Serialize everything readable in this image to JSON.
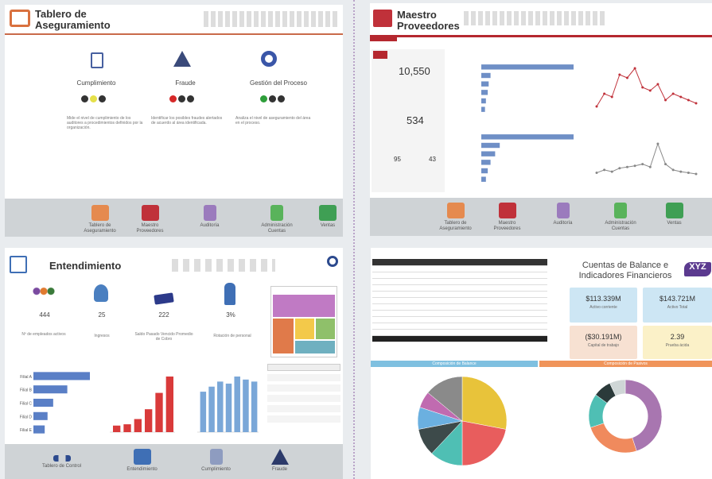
{
  "panel1": {
    "title_line1": "Tablero de",
    "title_line2": "Aseguramiento",
    "sections": [
      {
        "label": "Cumplimiento",
        "text": "Mide el nivel de cumplimiento de los auditores a procedimientos definidos por la organización."
      },
      {
        "label": "Fraude",
        "text": "Identificar los posibles fraudes alertados de acuerdo al área identificada."
      },
      {
        "label": "Gestión del Proceso",
        "text": "Analiza el nivel de aseguramiento del área en el proceso."
      }
    ],
    "nav": [
      {
        "label": "Tablero de Aseguramiento"
      },
      {
        "label": "Maestro Proveedores"
      },
      {
        "label": "Auditoría"
      },
      {
        "label": "Administración Cuentas"
      },
      {
        "label": "Ventas"
      }
    ]
  },
  "panel2": {
    "title_line1": "Maestro",
    "title_line2": "Proveedores",
    "kpi1": "10,550",
    "kpi2": "534",
    "kpi3a": "95",
    "kpi3b": "43",
    "chart_data": [
      {
        "type": "bar",
        "orientation": "horizontal",
        "categories": [
          "",
          "",
          "",
          "",
          "",
          ""
        ],
        "values": [
          100,
          10,
          8,
          7,
          5,
          4
        ]
      },
      {
        "type": "bar",
        "orientation": "horizontal",
        "categories": [
          "",
          "",
          "",
          "",
          "",
          ""
        ],
        "values": [
          100,
          20,
          15,
          10,
          7,
          5
        ]
      },
      {
        "type": "line",
        "values": [
          10,
          30,
          25,
          60,
          55,
          70,
          40,
          35,
          45,
          20,
          30,
          25,
          20,
          15
        ]
      },
      {
        "type": "line",
        "values": [
          10,
          15,
          12,
          18,
          20,
          22,
          25,
          20,
          60,
          25,
          15,
          12,
          10,
          8
        ]
      }
    ],
    "nav": [
      {
        "label": "Tablero de Aseguramiento"
      },
      {
        "label": "Maestro Proveedores"
      },
      {
        "label": "Auditoría"
      },
      {
        "label": "Administración Cuentas"
      },
      {
        "label": "Ventas"
      }
    ]
  },
  "panel3": {
    "title": "Entendimiento",
    "kpis": [
      {
        "value": "444",
        "label": "Nº de empleados activos"
      },
      {
        "value": "25",
        "label": "Ingresos"
      },
      {
        "value": "222",
        "label": "Saldo Pasado Vencido Promedio de Cobro"
      },
      {
        "value": "3%",
        "label": "Rotación de personal"
      }
    ],
    "chart_data": [
      {
        "type": "bar",
        "orientation": "horizontal",
        "categories": [
          "Filial A",
          "Filial B",
          "Filial C",
          "Filial D",
          "Filial E"
        ],
        "values": [
          100,
          60,
          35,
          25,
          20
        ]
      },
      {
        "type": "bar",
        "categories": [
          "",
          "",
          "",
          "",
          "",
          ""
        ],
        "values": [
          10,
          12,
          20,
          35,
          60,
          85
        ]
      },
      {
        "type": "bar",
        "categories": [
          "",
          "",
          "",
          "",
          "",
          "",
          ""
        ],
        "values": [
          40,
          45,
          50,
          48,
          55,
          52,
          50
        ]
      }
    ],
    "links": [
      "",
      "",
      "",
      "",
      "",
      ""
    ],
    "nav": [
      {
        "label": "Tablero de Control"
      },
      {
        "label": "Entendimiento"
      },
      {
        "label": "Cumplimiento"
      },
      {
        "label": "Fraude"
      }
    ]
  },
  "panel4": {
    "title_line1": "Cuentas de Balance e",
    "title_line2": "Indicadores Financieros",
    "badge": "XYZ",
    "cards": [
      {
        "value": "$113.339M",
        "label": "Activo corriente"
      },
      {
        "value": "$143.721M",
        "label": "Activo Total"
      },
      {
        "value": "($30.191M)",
        "label": "Capital de trabajo"
      },
      {
        "value": "2.39",
        "label": "Prueba ácida"
      }
    ],
    "table_rows": [
      [
        "",
        "",
        "",
        ""
      ],
      [
        "",
        "",
        "",
        ""
      ],
      [
        "",
        "",
        "",
        ""
      ],
      [
        "",
        "",
        "",
        ""
      ],
      [
        "",
        "",
        "",
        ""
      ],
      [
        "",
        "",
        "",
        ""
      ],
      [
        "",
        "",
        "",
        ""
      ],
      [
        "",
        "",
        "",
        ""
      ],
      [
        "",
        "",
        "",
        ""
      ],
      [
        "",
        "",
        "",
        ""
      ],
      [
        "",
        "",
        "",
        ""
      ]
    ],
    "pie_header": "Composición de Balance",
    "donut_header": "Composición de Pasivos",
    "chart_data": [
      {
        "type": "pie",
        "values": [
          28,
          22,
          12,
          10,
          8,
          6,
          14
        ],
        "colors": [
          "#e8c33a",
          "#e85d5d",
          "#4fbfb4",
          "#3d4a4a",
          "#6bb0e0",
          "#c06bb0",
          "#8a8a8a"
        ]
      },
      {
        "type": "pie",
        "donut": true,
        "values": [
          45,
          25,
          15,
          8,
          7
        ],
        "colors": [
          "#a876b0",
          "#f08a5d",
          "#4fbfb4",
          "#2b3a3a",
          "#cfd6d6"
        ]
      }
    ]
  },
  "colors": {
    "accent_red": "#b5282f",
    "accent_blue": "#5a6fa0",
    "nav_gray": "#cfd3d6",
    "kpi_blue": "#cde6f4",
    "kpi_orange": "#f7e1d2",
    "kpi_yellow": "#fbf1c8",
    "badge_purple": "#5b3a8f"
  }
}
